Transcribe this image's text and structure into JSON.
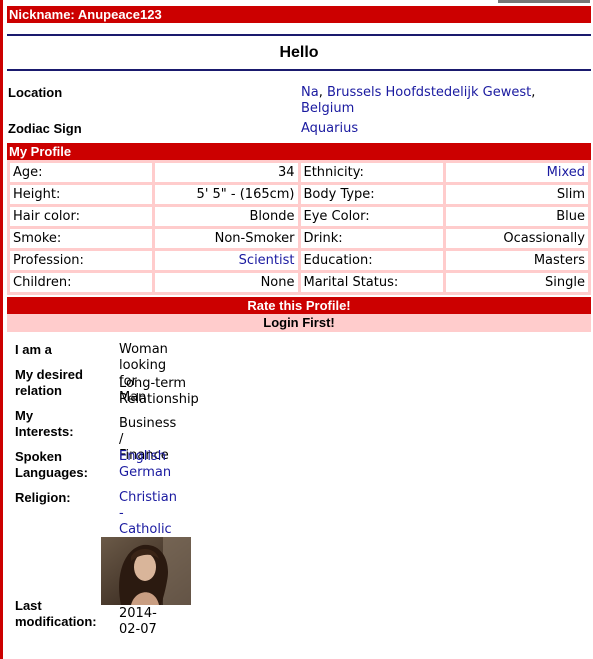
{
  "header": {
    "nickname": "Nickname: Anupeace123"
  },
  "greeting": "Hello",
  "location": {
    "label": "Location",
    "line1_a": "Na",
    "line1_sep": ", ",
    "line1_b": "Brussels Hoofdstedelijk Gewest",
    "line1_end": ",",
    "line2": "Belgium"
  },
  "zodiac": {
    "label": "Zodiac Sign",
    "value": "Aquarius"
  },
  "my_profile_title": "My Profile",
  "profile_rows": [
    {
      "l1": "Age:",
      "v1": "34",
      "l2": "Ethnicity:",
      "v2": "Mixed"
    },
    {
      "l1": "Height:",
      "v1": "5' 5\" - (165cm)",
      "l2": "Body Type:",
      "v2": "Slim"
    },
    {
      "l1": "Hair color:",
      "v1": "Blonde",
      "l2": "Eye Color:",
      "v2": "Blue"
    },
    {
      "l1": "Smoke:",
      "v1": "Non-Smoker",
      "l2": "Drink:",
      "v2": "Ocassionally"
    },
    {
      "l1": "Profession:",
      "v1": "Scientist",
      "l2": "Education:",
      "v2": "Masters"
    },
    {
      "l1": "Children:",
      "v1": "None",
      "l2": "Marital Status:",
      "v2": "Single"
    }
  ],
  "rate": {
    "title": "Rate this Profile!",
    "login": "Login First!"
  },
  "details": {
    "i_am": {
      "label": "I am a",
      "value": "Woman looking for Man"
    },
    "desired": {
      "label1": "My desired",
      "label2": "relation",
      "value": "Long-term Relationship"
    },
    "interests": {
      "label1": "My",
      "label2": "Interests:",
      "value": "Business / Finance"
    },
    "languages": {
      "label1": "Spoken",
      "label2": "Languages:",
      "value1": "English",
      "value2": "German"
    },
    "religion": {
      "label": "Religion:",
      "value": "Christian - Catholic"
    },
    "last_mod": {
      "label1": "Last",
      "label2": "modification:",
      "value": "2014-02-07"
    }
  }
}
